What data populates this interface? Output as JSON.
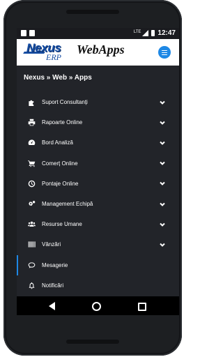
{
  "statusbar": {
    "network_label": "LTE",
    "time": "12:47"
  },
  "header": {
    "logo_text": "Nexus",
    "logo_sub": "ERP",
    "title": "WebApps"
  },
  "breadcrumb": "Nexus » Web » Apps",
  "menu": [
    {
      "label": "Suport Consultanți",
      "icon": "puzzle-icon",
      "has_chevron": true
    },
    {
      "label": "Rapoarte Online",
      "icon": "printer-icon",
      "has_chevron": true
    },
    {
      "label": "Bord Analiză",
      "icon": "gauge-icon",
      "has_chevron": true
    },
    {
      "label": "Comerț Online",
      "icon": "cart-icon",
      "has_chevron": true
    },
    {
      "label": "Pontaje Online",
      "icon": "clock-icon",
      "has_chevron": true
    },
    {
      "label": "Management Echipă",
      "icon": "cogs-icon",
      "has_chevron": true
    },
    {
      "label": "Resurse Umane",
      "icon": "users-icon",
      "has_chevron": true
    },
    {
      "label": "Vânzări",
      "icon": "barcode-icon",
      "has_chevron": true
    },
    {
      "label": "Mesagerie",
      "icon": "chat-icon",
      "has_chevron": false
    },
    {
      "label": "Notificări",
      "icon": "bell-icon",
      "has_chevron": false
    }
  ],
  "colors": {
    "accent": "#1e88e5",
    "brand": "#174ea3",
    "panel_bg": "#222429"
  }
}
